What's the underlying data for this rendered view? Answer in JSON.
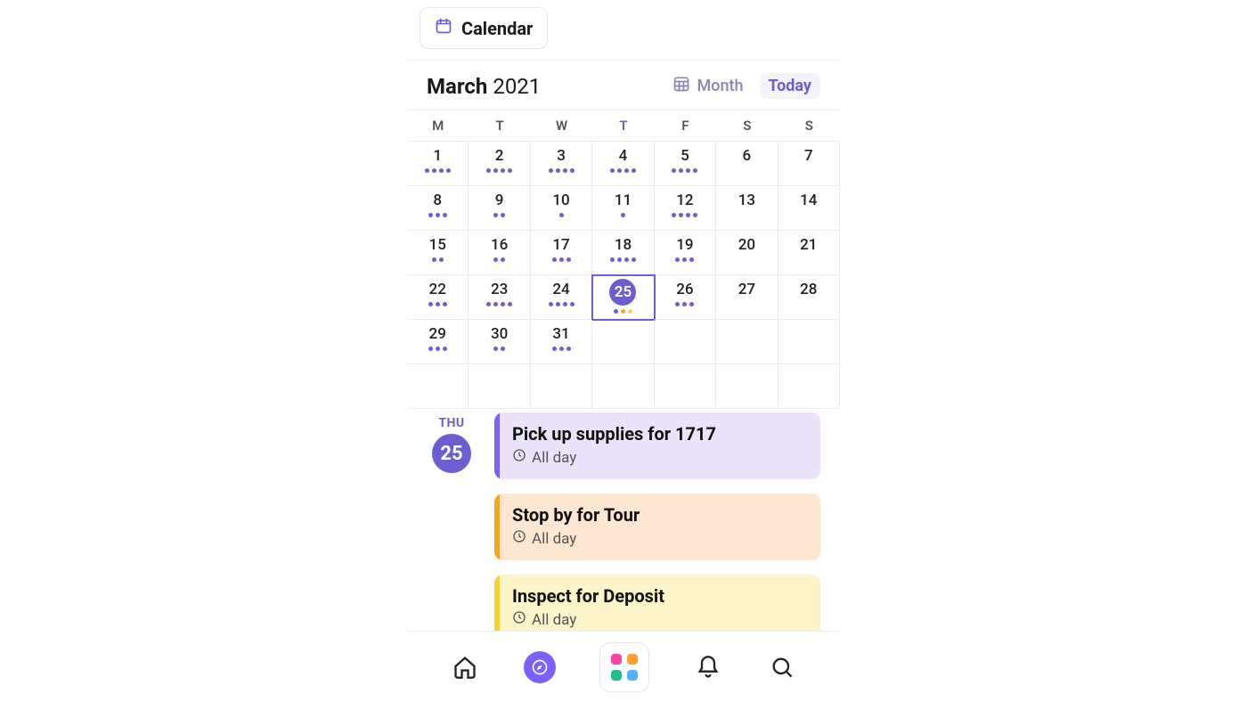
{
  "header": {
    "tab_label": "Calendar",
    "month": "March",
    "year": "2021",
    "view_label": "Month",
    "today_label": "Today"
  },
  "weekdays": [
    "M",
    "T",
    "W",
    "T",
    "F",
    "S",
    "S"
  ],
  "today_weekday_index": 3,
  "days": [
    {
      "n": "1",
      "dots": [
        "purple",
        "purple",
        "purple",
        "purple"
      ]
    },
    {
      "n": "2",
      "dots": [
        "purple",
        "purple",
        "purple",
        "purple"
      ]
    },
    {
      "n": "3",
      "dots": [
        "purple",
        "purple",
        "purple",
        "purple"
      ]
    },
    {
      "n": "4",
      "dots": [
        "purple",
        "purple",
        "purple",
        "purple"
      ]
    },
    {
      "n": "5",
      "dots": [
        "purple",
        "purple",
        "purple",
        "purple"
      ]
    },
    {
      "n": "6",
      "dots": []
    },
    {
      "n": "7",
      "dots": []
    },
    {
      "n": "8",
      "dots": [
        "purple",
        "purple",
        "purple"
      ]
    },
    {
      "n": "9",
      "dots": [
        "purple",
        "purple"
      ]
    },
    {
      "n": "10",
      "dots": [
        "purple"
      ]
    },
    {
      "n": "11",
      "dots": [
        "purple"
      ]
    },
    {
      "n": "12",
      "dots": [
        "purple",
        "purple",
        "purple",
        "purple"
      ]
    },
    {
      "n": "13",
      "dots": []
    },
    {
      "n": "14",
      "dots": []
    },
    {
      "n": "15",
      "dots": [
        "purple",
        "purple"
      ]
    },
    {
      "n": "16",
      "dots": [
        "purple",
        "purple"
      ]
    },
    {
      "n": "17",
      "dots": [
        "purple",
        "purple",
        "purple"
      ]
    },
    {
      "n": "18",
      "dots": [
        "purple",
        "purple",
        "purple",
        "purple"
      ]
    },
    {
      "n": "19",
      "dots": [
        "purple",
        "purple",
        "purple"
      ]
    },
    {
      "n": "20",
      "dots": []
    },
    {
      "n": "21",
      "dots": []
    },
    {
      "n": "22",
      "dots": [
        "purple",
        "purple",
        "purple"
      ]
    },
    {
      "n": "23",
      "dots": [
        "purple",
        "purple",
        "purple",
        "purple"
      ]
    },
    {
      "n": "24",
      "dots": [
        "purple",
        "purple",
        "purple",
        "purple"
      ]
    },
    {
      "n": "25",
      "dots": [
        "purple",
        "orange",
        "yellow"
      ],
      "selected": true
    },
    {
      "n": "26",
      "dots": [
        "purple",
        "purple",
        "purple"
      ]
    },
    {
      "n": "27",
      "dots": []
    },
    {
      "n": "28",
      "dots": []
    },
    {
      "n": "29",
      "dots": [
        "purple",
        "purple",
        "purple"
      ]
    },
    {
      "n": "30",
      "dots": [
        "purple",
        "purple"
      ]
    },
    {
      "n": "31",
      "dots": [
        "purple",
        "purple",
        "purple"
      ]
    },
    {
      "n": "",
      "dots": []
    },
    {
      "n": "",
      "dots": []
    },
    {
      "n": "",
      "dots": []
    },
    {
      "n": "",
      "dots": []
    },
    {
      "n": "",
      "dots": []
    },
    {
      "n": "",
      "dots": []
    },
    {
      "n": "",
      "dots": []
    },
    {
      "n": "",
      "dots": []
    },
    {
      "n": "",
      "dots": []
    },
    {
      "n": "",
      "dots": []
    },
    {
      "n": "",
      "dots": []
    }
  ],
  "selected_day": {
    "dow": "THU",
    "num": "25"
  },
  "events": [
    {
      "title": "Pick up supplies for 1717",
      "time": "All day",
      "color": "purple"
    },
    {
      "title": "Stop by for Tour",
      "time": "All day",
      "color": "orange"
    },
    {
      "title": "Inspect for Deposit",
      "time": "All day",
      "color": "yellow"
    }
  ],
  "nav": {
    "apps_colors": [
      "#ff3ea5",
      "#ff9f2e",
      "#1fbf86",
      "#4fb3ff"
    ]
  }
}
